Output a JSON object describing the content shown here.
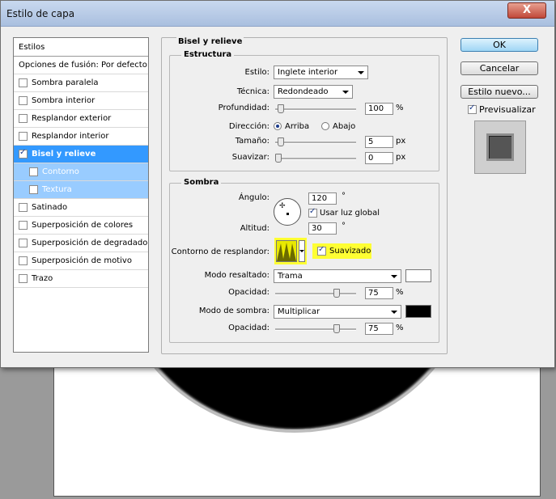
{
  "window": {
    "title": "Estilo de capa",
    "close_label": "X"
  },
  "styles_list": {
    "header": "Estilos",
    "blend_options": "Opciones de fusión: Por defecto",
    "items": [
      {
        "label": "Sombra paralela",
        "checked": false
      },
      {
        "label": "Sombra interior",
        "checked": false
      },
      {
        "label": "Resplandor exterior",
        "checked": false
      },
      {
        "label": "Resplandor interior",
        "checked": false
      },
      {
        "label": "Bisel y relieve",
        "checked": true
      },
      {
        "label": "Contorno",
        "checked": false
      },
      {
        "label": "Textura",
        "checked": false
      },
      {
        "label": "Satinado",
        "checked": false
      },
      {
        "label": "Superposición de colores",
        "checked": false
      },
      {
        "label": "Superposición de degradado",
        "checked": false
      },
      {
        "label": "Superposición de motivo",
        "checked": false
      },
      {
        "label": "Trazo",
        "checked": false
      }
    ]
  },
  "bevel": {
    "title": "Bisel y relieve",
    "structure": {
      "title": "Estructura",
      "style_label": "Estilo:",
      "style_value": "Inglete interior",
      "technique_label": "Técnica:",
      "technique_value": "Redondeado",
      "depth_label": "Profundidad:",
      "depth_value": "100",
      "depth_unit": "%",
      "direction_label": "Dirección:",
      "dir_up": "Arriba",
      "dir_down": "Abajo",
      "size_label": "Tamaño:",
      "size_value": "5",
      "size_unit": "px",
      "soften_label": "Suavizar:",
      "soften_value": "0",
      "soften_unit": "px"
    },
    "shading": {
      "title": "Sombra",
      "angle_label": "Ángulo:",
      "angle_value": "120",
      "angle_unit": "°",
      "global_light_label": "Usar luz global",
      "altitude_label": "Altitud:",
      "altitude_value": "30",
      "altitude_unit": "°",
      "gloss_label": "Contorno de resplandor:",
      "antialiased_label": "Suavizado",
      "highlight_mode_label": "Modo resaltado:",
      "highlight_mode_value": "Trama",
      "highlight_color": "#ffffff",
      "highlight_opacity_label": "Opacidad:",
      "highlight_opacity_value": "75",
      "highlight_opacity_unit": "%",
      "shadow_mode_label": "Modo de sombra:",
      "shadow_mode_value": "Multiplicar",
      "shadow_color": "#000000",
      "shadow_opacity_label": "Opacidad:",
      "shadow_opacity_value": "75",
      "shadow_opacity_unit": "%"
    }
  },
  "actions": {
    "ok": "OK",
    "cancel": "Cancelar",
    "new_style": "Estilo nuevo...",
    "preview_label": "Previsualizar"
  }
}
